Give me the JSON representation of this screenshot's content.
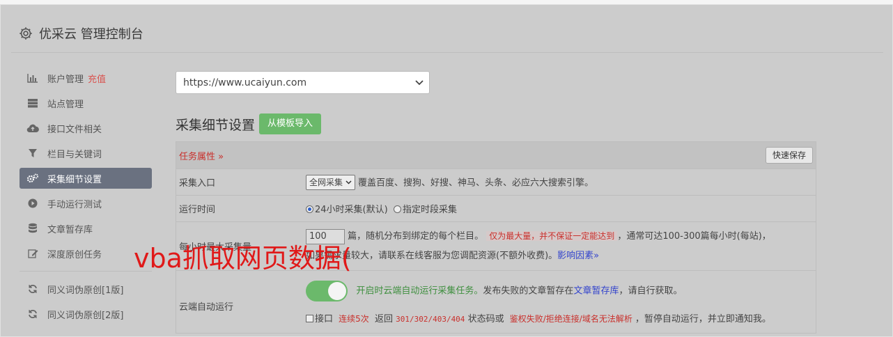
{
  "header": {
    "title": "优采云 管理控制台"
  },
  "sidebar": {
    "items": [
      {
        "label": "账户管理",
        "badge": "充值",
        "icon": "bar-chart-icon"
      },
      {
        "label": "站点管理",
        "icon": "server-icon"
      },
      {
        "label": "接口文件相关",
        "icon": "cloud-upload-icon"
      },
      {
        "label": "栏目与关键词",
        "icon": "filter-icon"
      },
      {
        "label": "采集细节设置",
        "icon": "gears-icon",
        "active": true
      },
      {
        "label": "手动运行测试",
        "icon": "play-circle-icon"
      },
      {
        "label": "文章暂存库",
        "icon": "database-icon"
      },
      {
        "label": "深度原创任务",
        "icon": "edit-icon"
      }
    ],
    "items2": [
      {
        "label": "同义词伪原创[1版]",
        "icon": "refresh-icon"
      },
      {
        "label": "同义词伪原创[2版]",
        "icon": "refresh-icon"
      }
    ]
  },
  "main": {
    "site_select": "https://www.ucaiyun.com",
    "section_title": "采集细节设置",
    "import_button": "从模板导入",
    "panel_title": "任务属性",
    "save_button": "快速保存",
    "rows": {
      "entry_label": "采集入口",
      "entry_select": "全网采集",
      "entry_desc": "覆盖百度、搜狗、好搜、神马、头条、必应六大搜索引擎。",
      "time_label": "运行时间",
      "time_opt1": "24小时采集(默认)",
      "time_opt2": "指定时段采集",
      "max_label": "每小时最大采集量",
      "max_value": "100",
      "max_text1": "篇，随机分布到绑定的每个栏目。",
      "max_hl": "仅为最大量，并不保证一定能达到",
      "max_text2": "，通常可达100-300篇每小时(每站)，",
      "max_text3": "如果需求量较大，请联系在线客服为您调配资源(不额外收费)。",
      "max_link": "影响因素",
      "cloud_label": "云端自动运行",
      "cloud_text1": "开启时云端自动运行采集任务。",
      "cloud_text2": "发布失败的文章暂存在",
      "cloud_link": "文章暂存库",
      "cloud_text3": "，请自行获取。",
      "iface_text1": "接口",
      "iface_hl1": "连续5次",
      "iface_text2": "返回",
      "iface_hl2": "301/302/403/404",
      "iface_text3": "状态码或",
      "iface_hl3": "鉴权失败/拒绝连接/域名无法解析",
      "iface_text4": "，暂停自动运行，并立即通知我。"
    }
  },
  "watermark": "vba抓取网页数据("
}
